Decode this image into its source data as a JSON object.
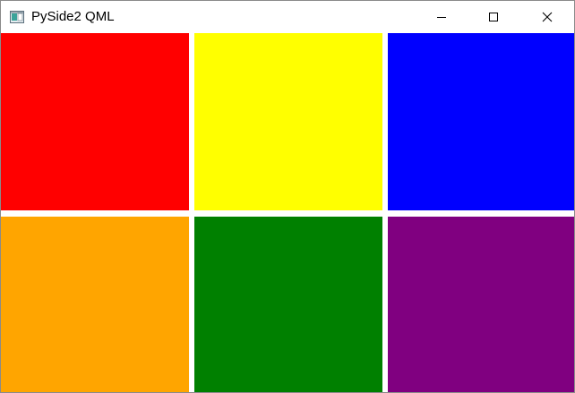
{
  "window": {
    "title": "PySide2 QML"
  },
  "titlebar": {
    "app_icon": "qt-window-icon",
    "controls": [
      {
        "name": "minimize-button",
        "icon": "minimize-icon"
      },
      {
        "name": "maximize-button",
        "icon": "maximize-icon"
      },
      {
        "name": "close-button",
        "icon": "close-icon"
      }
    ]
  },
  "grid": {
    "rows": 2,
    "columns": 3,
    "tiles": [
      {
        "name": "tile-red",
        "color": "#ff0000"
      },
      {
        "name": "tile-yellow",
        "color": "#ffff00"
      },
      {
        "name": "tile-blue",
        "color": "#0000ff"
      },
      {
        "name": "tile-orange",
        "color": "#ffa500"
      },
      {
        "name": "tile-green",
        "color": "#008000"
      },
      {
        "name": "tile-purple",
        "color": "#800080"
      }
    ]
  }
}
